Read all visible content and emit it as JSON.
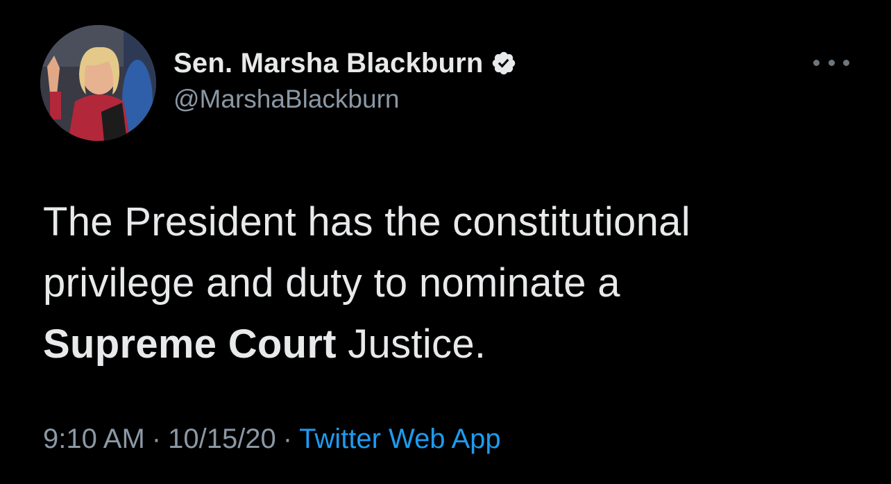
{
  "author": {
    "display_name": "Sen. Marsha Blackburn",
    "handle": "@MarshaBlackburn",
    "verified": true
  },
  "tweet": {
    "line1": "The President has the constitutional",
    "line2": "privilege and duty to nominate a",
    "line3_bold": "Supreme Court",
    "line3_rest": " Justice."
  },
  "meta": {
    "time": "9:10 AM",
    "separator": "·",
    "date": "10/15/20",
    "source": "Twitter Web App"
  },
  "colors": {
    "background": "#000000",
    "text": "#e7e9ea",
    "secondary": "#8b98a5",
    "link": "#1d9bf0"
  },
  "icons": {
    "verified": "verified-badge-icon",
    "more": "more-options-icon"
  }
}
